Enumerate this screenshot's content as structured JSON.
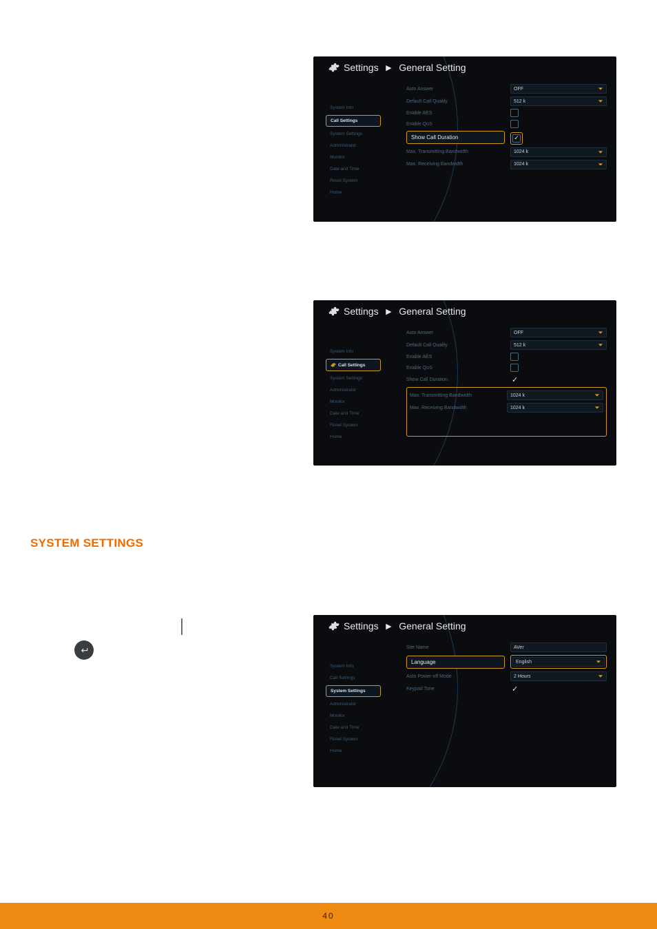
{
  "page": {
    "number": "40"
  },
  "section": {
    "heading": "SYSTEM SETTINGS"
  },
  "breadcrumb": {
    "root": "Settings",
    "leaf": "General Setting",
    "sep": "►"
  },
  "sidebar": {
    "items": [
      "System Info",
      "Call Settings",
      "System Settings",
      "Administrator",
      "Monitor",
      "Date and Time",
      "Reset System",
      "Home"
    ]
  },
  "call_settings": {
    "rows": {
      "auto_answer": {
        "label": "Auto Answer",
        "value": "OFF"
      },
      "default_quality": {
        "label": "Default Call Quality",
        "value": "512 k"
      },
      "enable_aes": {
        "label": "Enable AES"
      },
      "enable_qos": {
        "label": "Enable QoS"
      },
      "show_duration": {
        "label": "Show Call Duration"
      },
      "tx_bw": {
        "label": "Max. Transmitting Bandwidth",
        "value": "1024 k"
      },
      "rx_bw": {
        "label": "Max. Receiving Bandwidth",
        "value": "1024 k"
      }
    }
  },
  "system_settings": {
    "rows": {
      "site_name": {
        "label": "Site Name",
        "value": "AVer"
      },
      "language": {
        "label": "Language",
        "value": "English"
      },
      "auto_off": {
        "label": "Auto Power-off Mode",
        "value": "2 Hours"
      },
      "keypad_tone": {
        "label": "Keypad Tone"
      }
    }
  }
}
